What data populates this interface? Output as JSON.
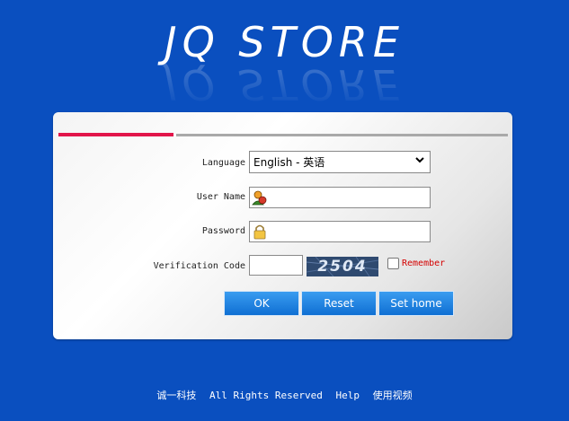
{
  "brand": {
    "title": "JQ STORE"
  },
  "form": {
    "language_label": "Language",
    "language_value": "English - 英语",
    "username_label": "User Name",
    "username_value": "",
    "password_label": "Password",
    "password_value": "",
    "verification_label": "Verification Code",
    "verification_value": "",
    "captcha_text": "2504",
    "remember_label": "Remember",
    "remember_checked": false
  },
  "buttons": {
    "ok": "OK",
    "reset": "Reset",
    "sethome": "Set home"
  },
  "footer": {
    "company": "诚一科技",
    "rights": "All Rights Reserved",
    "help": "Help",
    "video": "使用视频"
  },
  "colors": {
    "background": "#0a4fbf",
    "accent_bar": "#e2154a",
    "button": "#1f82e0",
    "remember_text": "#d40000"
  },
  "icons": {
    "username": "user-avatar-icon",
    "password": "lock-icon",
    "select": "chevron-down-icon"
  }
}
